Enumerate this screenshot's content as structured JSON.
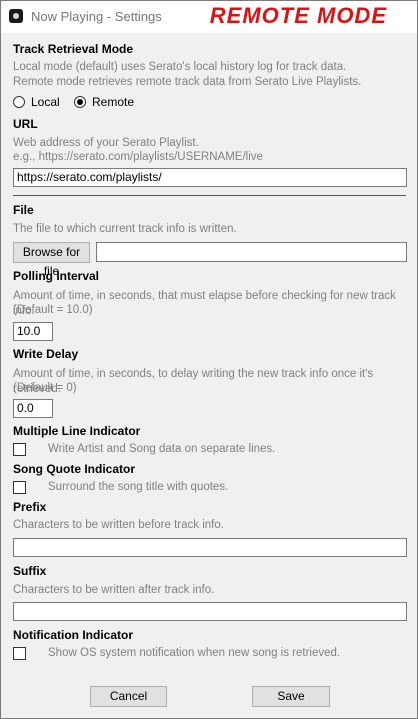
{
  "window": {
    "title": "Now Playing - Settings",
    "mode_banner": "REMOTE MODE"
  },
  "track_retrieval": {
    "heading": "Track Retrieval Mode",
    "desc_line1": "Local mode (default) uses Serato's local history log for track data.",
    "desc_line2": "Remote mode retrieves remote track data from Serato Live Playlists.",
    "options": [
      {
        "label": "Local",
        "selected": false
      },
      {
        "label": "Remote",
        "selected": true
      }
    ]
  },
  "url": {
    "heading": "URL",
    "desc_line1": "Web address of your Serato Playlist.",
    "desc_line2": "e.g., https://serato.com/playlists/USERNAME/live",
    "value": "https://serato.com/playlists/"
  },
  "file": {
    "heading": "File",
    "desc": "The file to which current track info is written.",
    "browse_label": "Browse for file",
    "value": ""
  },
  "polling": {
    "heading": "Polling Interval",
    "desc_line1": "Amount of time, in seconds, that must elapse before checking for new track info.",
    "desc_line2": "(Default = 10.0)",
    "value": "10.0"
  },
  "write_delay": {
    "heading": "Write Delay",
    "desc_line1": "Amount of time, in seconds, to delay writing the new track info once it's retrieved.",
    "desc_line2": "(Default = 0)",
    "value": "0.0"
  },
  "multiline": {
    "heading": "Multiple Line Indicator",
    "label": "Write Artist and Song data on separate lines.",
    "checked": false
  },
  "quote": {
    "heading": "Song Quote Indicator",
    "label": "Surround the song title with quotes.",
    "checked": false
  },
  "prefix": {
    "heading": "Prefix",
    "desc": "Characters to be written before track info.",
    "value": ""
  },
  "suffix": {
    "heading": "Suffix",
    "desc": "Characters to be written after track info.",
    "value": ""
  },
  "notification": {
    "heading": "Notification Indicator",
    "label": "Show OS system notification when new song is retrieved.",
    "checked": false
  },
  "buttons": {
    "cancel": "Cancel",
    "save": "Save"
  },
  "colors": {
    "banner": "#e01010",
    "description": "#808080",
    "window_bg": "#f0f0f0"
  }
}
